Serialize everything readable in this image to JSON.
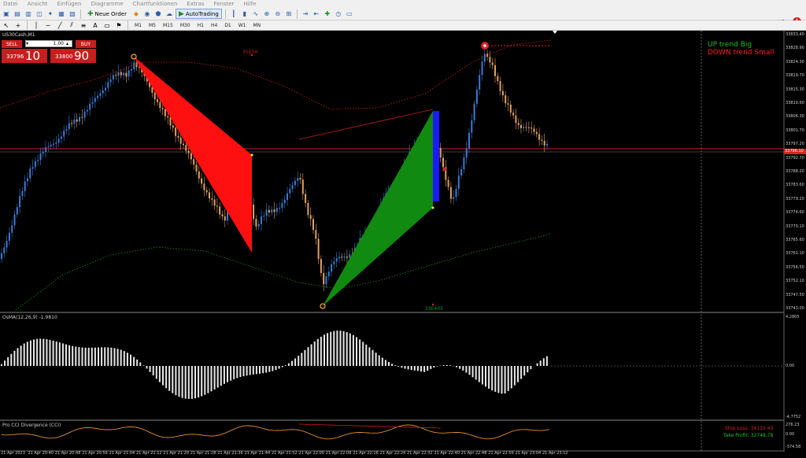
{
  "menu": {
    "items": [
      "Datei",
      "Ansicht",
      "Einfügen",
      "Diagramme",
      "Chartfunktionen",
      "Extras",
      "Fenster",
      "Hilfe"
    ]
  },
  "toolbar": {
    "new_order_label": "Neue Order",
    "autotrading_label": "AutoTrading",
    "timeframes": [
      "M1",
      "M5",
      "M15",
      "M30",
      "H1",
      "H4",
      "D1",
      "W1",
      "MN"
    ],
    "alert_count": "!"
  },
  "chart": {
    "symbol": "US30Cash,M1",
    "trade_panel": {
      "sell_label": "SELL",
      "buy_label": "BUY",
      "lot_value": "1.00",
      "sell_price_small": "33796",
      "sell_price_big": "10",
      "buy_price_small": "33800",
      "buy_price_big": "90"
    },
    "legend": {
      "up": "UP trend Big",
      "down": "DOWN trend Small"
    },
    "top_label": "35E3H",
    "bottom_label": "33E403",
    "current_price": "33796.10",
    "price_axis": [
      "33833.40",
      "33828.90",
      "33824.30",
      "33819.70",
      "33815.30",
      "33810.60",
      "33806.30",
      "33801.70",
      "33797.20",
      "33792.70",
      "33788.20",
      "33783.60",
      "33779.20",
      "33774.60",
      "33770.10",
      "33765.60",
      "33761.10",
      "33756.50",
      "33752.10",
      "33747.50",
      "33743.00"
    ],
    "osma_label": "OsMA(12,26,9) -1.9810",
    "osma_axis": [
      "4.2805",
      "0.00",
      "-4.7752"
    ],
    "cci_label": "Pro CCI Divergence (CCI)",
    "cci_axis": [
      "276.23",
      "0.00",
      "-374.58"
    ],
    "stop_loss": "Stop Loss: 34133.43",
    "take_profit": "Take Profit: 32748.78",
    "time_axis": [
      "21 Apr 2023",
      "21 Apr 20:40",
      "21 Apr 20:48",
      "21 Apr 20:56",
      "21 Apr 21:04",
      "21 Apr 21:12",
      "21 Apr 21:20",
      "21 Apr 21:28",
      "21 Apr 21:36",
      "21 Apr 21:44",
      "21 Apr 21:52",
      "21 Apr 22:00",
      "21 Apr 22:08",
      "21 Apr 22:16",
      "21 Apr 22:24",
      "21 Apr 22:32",
      "21 Apr 22:40",
      "21 Apr 22:48",
      "21 Apr 22:56",
      "21 Apr 23:04",
      "21 Apr 23:12"
    ]
  },
  "colors": {
    "bull": "#3a7bd5",
    "bear": "#e0a060",
    "sell_red": "#c81e1e",
    "up_green": "#1fbf1f",
    "down_red": "#ff2020"
  }
}
